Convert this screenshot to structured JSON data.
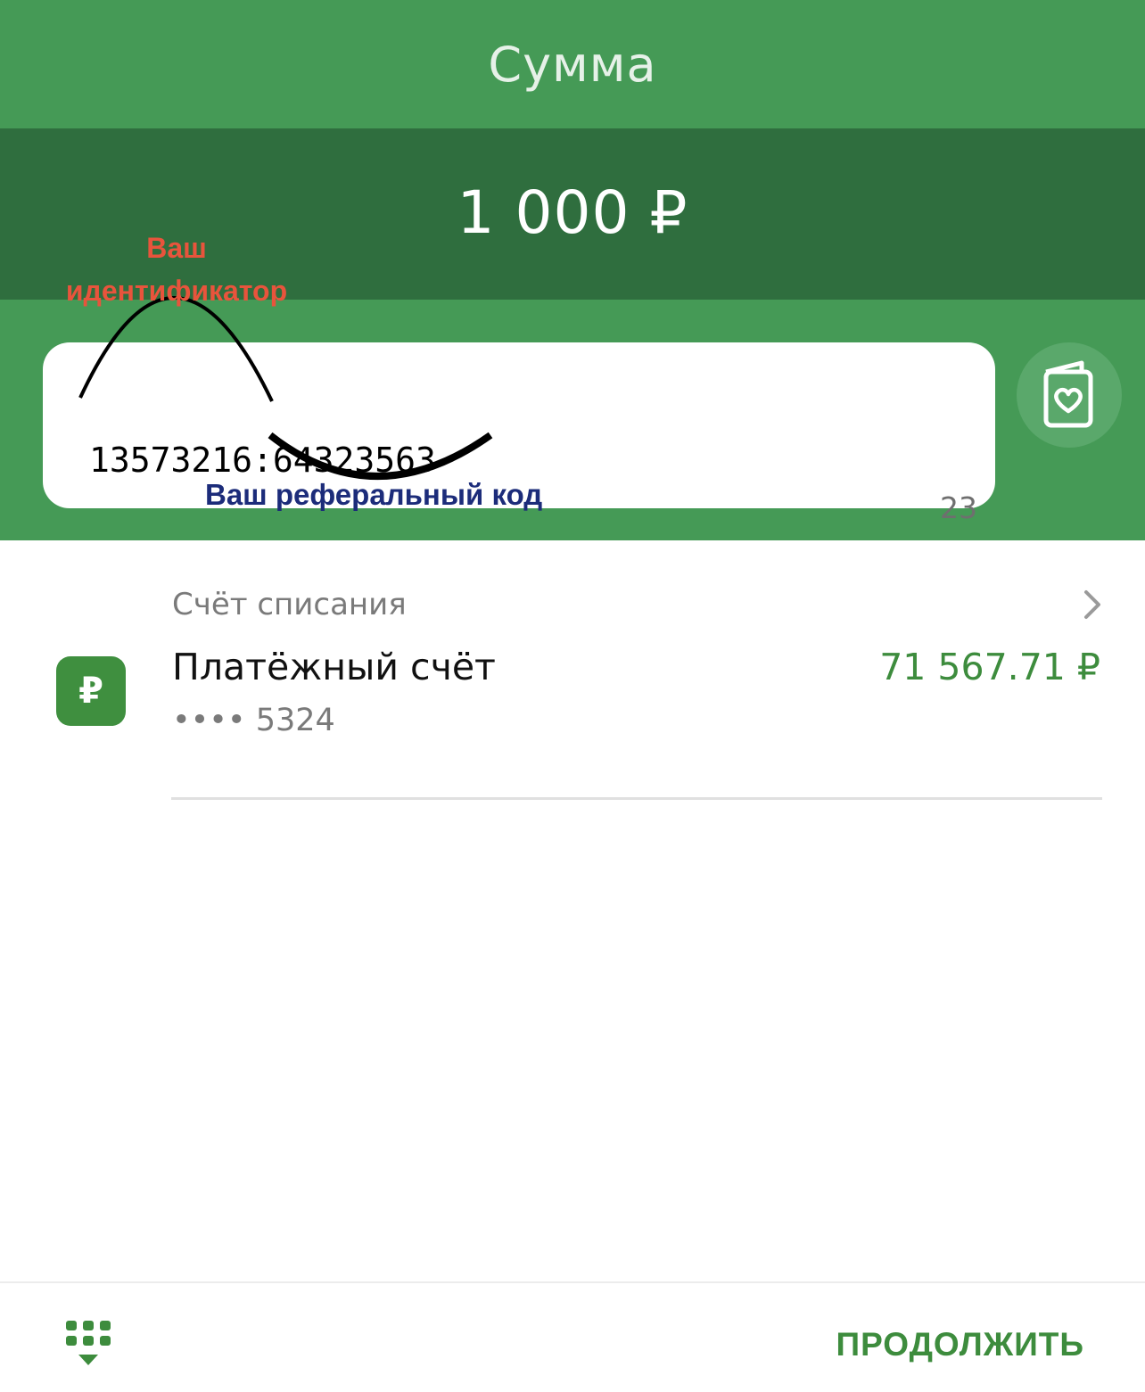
{
  "header": {
    "title": "Сумма"
  },
  "amount": {
    "value": "1 000 ₽"
  },
  "message": {
    "text": "13573216:64323563",
    "counter": "23",
    "template_icon": "postcard-heart-icon"
  },
  "annotations": {
    "identifier_label": "Ваш идентификатор",
    "referral_label": "Ваш реферальный код",
    "identifier_color": "#e8543c",
    "referral_color": "#1c2c7a"
  },
  "account": {
    "caption": "Счёт списания",
    "name": "Платёжный счёт",
    "balance": "71 567.71 ₽",
    "number": "•••• 5324",
    "icon": "ruble-icon",
    "icon_glyph": "₽"
  },
  "bottom": {
    "keyboard_icon": "keyboard-hide-icon",
    "continue_label": "ПРОДОЛЖИТЬ"
  },
  "colors": {
    "primary_green": "#459a56",
    "dark_green": "#2f6e3e",
    "accent_green": "#3d8c3d"
  }
}
